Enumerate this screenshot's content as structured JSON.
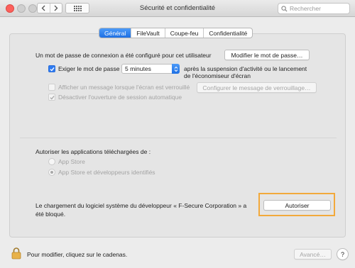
{
  "window": {
    "title": "Sécurité et confidentialité",
    "search_placeholder": "Rechercher"
  },
  "tabs": [
    {
      "label": "Général",
      "active": true
    },
    {
      "label": "FileVault",
      "active": false
    },
    {
      "label": "Coupe-feu",
      "active": false
    },
    {
      "label": "Confidentialité",
      "active": false
    }
  ],
  "general": {
    "password_set_text": "Un mot de passe de connexion a été configuré pour cet utilisateur",
    "change_password_button": "Modifier le mot de passe…",
    "require_password_label": "Exiger le mot de passe",
    "require_password_checked": true,
    "require_password_delay": "5 minutes",
    "require_password_suffix_line1": "après la suspension d'activité ou le lancement",
    "require_password_suffix_line2": "de l'économiseur d'écran",
    "show_message_label": "Afficher un message lorsque l'écran est verrouillé",
    "show_message_checked": false,
    "set_lock_message_button": "Configurer le message de verrouillage…",
    "disable_autologin_label": "Désactiver l'ouverture de session automatique",
    "disable_autologin_checked": true
  },
  "downloads": {
    "heading": "Autoriser les applications téléchargées de :",
    "options": [
      {
        "label": "App Store",
        "selected": false
      },
      {
        "label": "App Store et développeurs identifiés",
        "selected": true
      }
    ]
  },
  "blocked": {
    "message_line1": "Le chargement du logiciel système du développeur « F-Secure Corporation » a",
    "message_line2": "été bloqué.",
    "allow_button": "Autoriser"
  },
  "footer": {
    "lock_text": "Pour modifier, cliquez sur le cadenas.",
    "advanced_button": "Avancé…",
    "help_button": "?"
  },
  "colors": {
    "accent": "#2f7bf1",
    "highlight": "#f2a93b",
    "close": "#fc605c"
  }
}
